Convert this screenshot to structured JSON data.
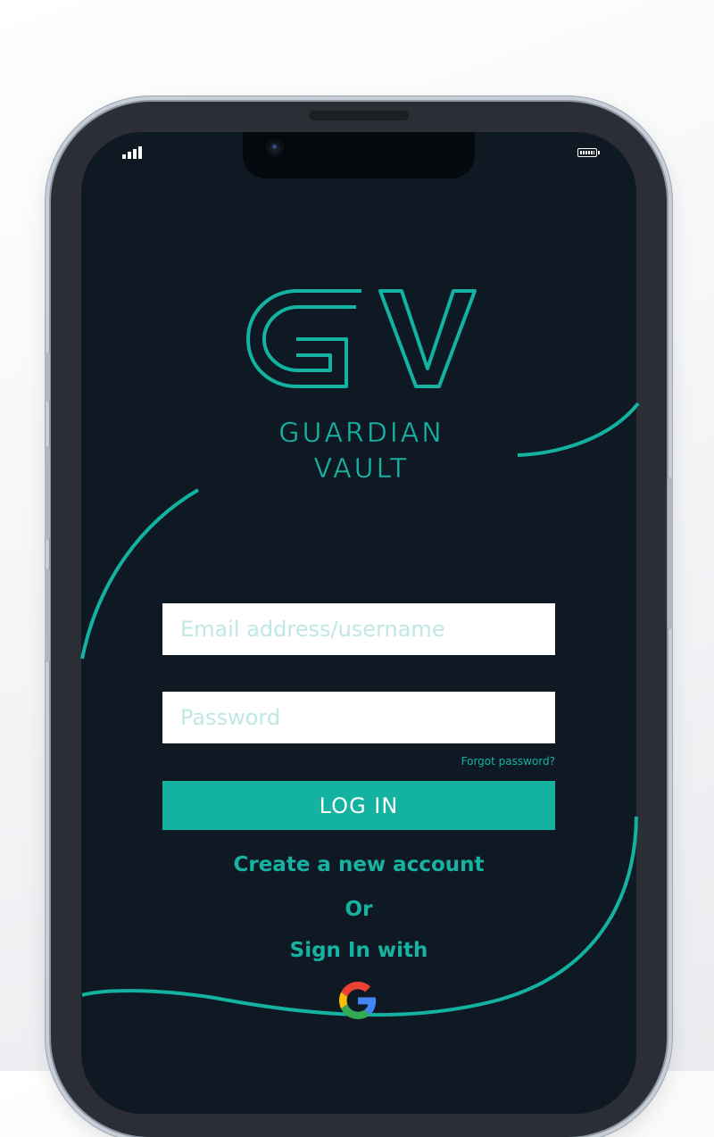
{
  "status_bar": {
    "signal_icon": "signal-bars-icon",
    "battery_icon": "battery-icon"
  },
  "brand": {
    "monogram": "GV",
    "name_line1": "GUARDIAN",
    "name_line2": "VAULT"
  },
  "login_form": {
    "email_placeholder": "Email address/username",
    "password_placeholder": "Password",
    "forgot_password": "Forgot password?",
    "login_label": "LOG IN"
  },
  "create_account": "Create a new account",
  "or_label": "Or",
  "sign_in_with": "Sign In with",
  "social": {
    "provider_icon": "google-icon"
  },
  "colors": {
    "accent": "#13b2a1",
    "screen_background": "#0f1924",
    "field_background": "#ffffff",
    "placeholder": "#bfe7e3"
  }
}
